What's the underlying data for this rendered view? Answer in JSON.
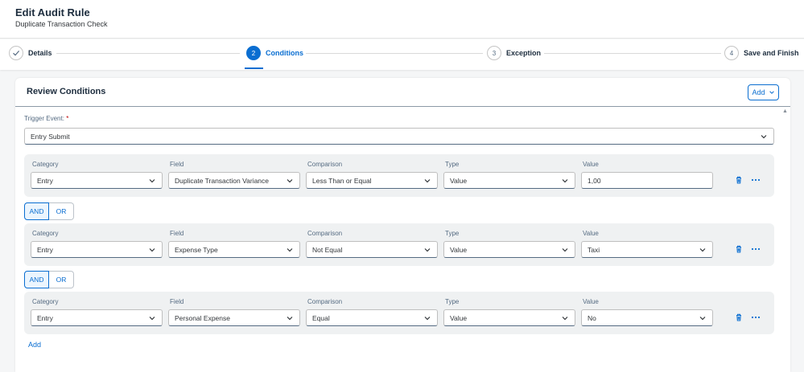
{
  "header": {
    "title": "Edit Audit Rule",
    "subtitle": "Duplicate Transaction Check"
  },
  "steps": [
    {
      "number": "",
      "label": "Details",
      "state": "done"
    },
    {
      "number": "2",
      "label": "Conditions",
      "state": "active"
    },
    {
      "number": "3",
      "label": "Exception",
      "state": "pending"
    },
    {
      "number": "4",
      "label": "Save and Finish",
      "state": "pending"
    }
  ],
  "card": {
    "title": "Review Conditions",
    "add_label": "Add",
    "trigger_label": "Trigger Event:",
    "trigger_required": "*",
    "trigger_value": "Entry Submit",
    "add_link": "Add"
  },
  "column_labels": {
    "category": "Category",
    "field": "Field",
    "comparison": "Comparison",
    "type": "Type",
    "value": "Value"
  },
  "conditions": [
    {
      "category": "Entry",
      "field": "Duplicate Transaction Variance",
      "comparison": "Less Than or Equal",
      "type": "Value",
      "value": "1,00"
    },
    {
      "category": "Entry",
      "field": "Expense Type",
      "comparison": "Not Equal",
      "type": "Value",
      "value": "Taxi"
    },
    {
      "category": "Entry",
      "field": "Personal Expense",
      "comparison": "Equal",
      "type": "Value",
      "value": "No"
    }
  ],
  "logic": {
    "and_label": "AND",
    "or_label": "OR"
  },
  "colors": {
    "accent": "#0a6ed1",
    "required": "#bb0000"
  }
}
